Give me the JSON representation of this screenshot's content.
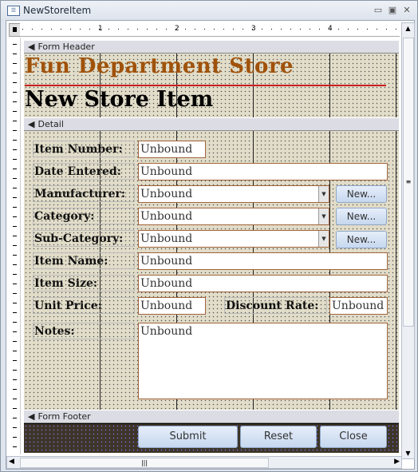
{
  "window": {
    "title": "NewStoreItem",
    "icon": "form-icon"
  },
  "ruler": {
    "marks": [
      "1",
      "2",
      "3",
      "4"
    ]
  },
  "sections": {
    "header": "Form Header",
    "detail": "Detail",
    "footer": "Form Footer"
  },
  "header": {
    "store_name": "Fun Department Store",
    "form_title": "New Store Item",
    "store_color": "#a0520a"
  },
  "fields": [
    {
      "label": "Item Number:",
      "value": "Unbound"
    },
    {
      "label": "Date Entered:",
      "value": "Unbound"
    },
    {
      "label": "Manufacturer:",
      "value": "Unbound",
      "button": "New..."
    },
    {
      "label": "Category:",
      "value": "Unbound",
      "button": "New..."
    },
    {
      "label": "Sub-Category:",
      "value": "Unbound",
      "button": "New..."
    },
    {
      "label": "Item Name:",
      "value": "Unbound"
    },
    {
      "label": "Item Size:",
      "value": "Unbound"
    },
    {
      "label": "Unit Price:",
      "value": "Unbound"
    },
    {
      "label": "Notes:",
      "value": "Unbound"
    }
  ],
  "discount": {
    "label": "Discount Rate:",
    "value": "Unbound"
  },
  "footer": {
    "submit": "Submit",
    "reset": "Reset",
    "close": "Close"
  }
}
